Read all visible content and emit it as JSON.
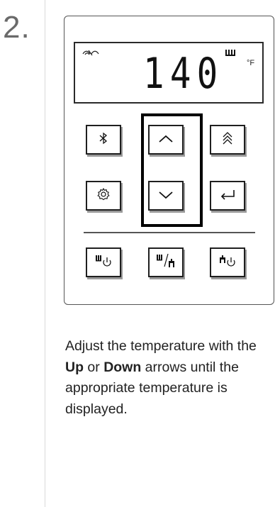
{
  "step": {
    "number": "2."
  },
  "display": {
    "temperature": "140",
    "unit": "°F",
    "wifi_icon": "wifi-connection-icon",
    "heating_icon": "heating-indicator-icon"
  },
  "buttons": [
    {
      "id": "bluetooth",
      "icon": "bluetooth-icon",
      "glyph": "∗"
    },
    {
      "id": "up",
      "icon": "chevron-up-icon",
      "glyph": "︿"
    },
    {
      "id": "priority-up",
      "icon": "double-chevron-up-icon",
      "glyph": "︽"
    },
    {
      "id": "settings",
      "icon": "gear-icon",
      "glyph": "⚙"
    },
    {
      "id": "down",
      "icon": "chevron-down-icon",
      "glyph": "﹀"
    },
    {
      "id": "enter",
      "icon": "enter-return-icon",
      "glyph": "↵"
    },
    {
      "id": "heater-power",
      "icon": "heater-power-icon"
    },
    {
      "id": "heater-hot-water",
      "icon": "heater-hot-water-icon"
    },
    {
      "id": "hot-water-power",
      "icon": "hot-water-power-icon"
    }
  ],
  "instructions": {
    "before": "Adjust the temperature with the ",
    "up": "Up",
    "middle": " or ",
    "down": "Down",
    "after": " arrows until the appropriate temperature is displayed."
  }
}
